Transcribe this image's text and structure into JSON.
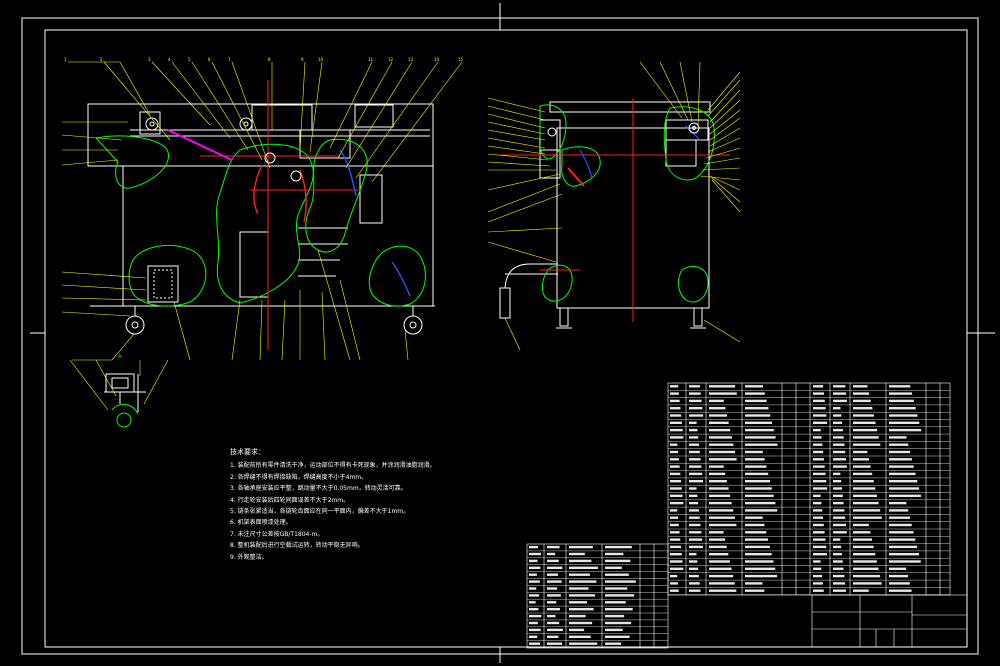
{
  "notes": {
    "title": "技术要求：",
    "lines": [
      "1. 装配前所有零件清洗干净，运动部位不得有卡死现象，并涂润滑油脂润滑。",
      "2. 各焊缝不得有焊接缺陷，焊缝高度不小于4mm。",
      "3. 各轴承座安装应平整，跳动量不大于0.05mm，转动灵活可靠。",
      "4. 行走轮安装后四轮同面误差不大于2mm。",
      "5. 链条张紧适当，各链轮齿面应在同一平面内，偏差不大于1mm。",
      "6. 机架表面喷漆处理。",
      "7. 未注尺寸公差按GB/T1804-m。",
      "8. 整机装配后进行空载试运转，转动平稳无异响。",
      "9. 外观整洁。"
    ]
  },
  "colors": {
    "background": "#000000",
    "line": "#ffffff",
    "outline_green": "#00ff00",
    "centerline_red": "#ff2020",
    "hydraulic_blue": "#3050ff",
    "leader_yellow": "#ffff00",
    "accent_magenta": "#ff00ff"
  }
}
